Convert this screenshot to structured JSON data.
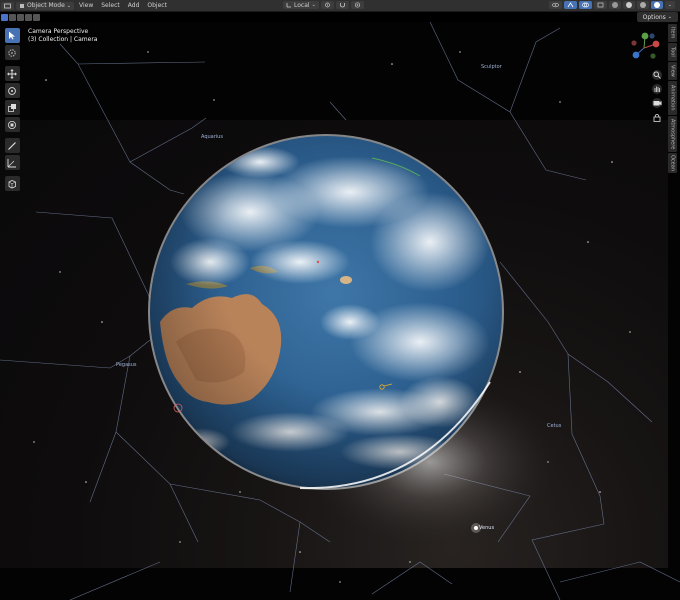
{
  "header": {
    "mode": "Object Mode",
    "menus": [
      "View",
      "Select",
      "Add",
      "Object"
    ],
    "transform_orientation": "Local",
    "options_label": "Options"
  },
  "overlay": {
    "line1": "Camera Perspective",
    "line2": "(3) Collection | Camera"
  },
  "constellations": [
    "Sculptor",
    "Aquarius",
    "Pegasus",
    "Cetus",
    "Venus"
  ],
  "side_tabs": [
    "Item",
    "Tool",
    "View",
    "Animation",
    "Atmosphere",
    "Ocean"
  ],
  "colors": {
    "header_bg": "#303030",
    "accent": "#4772b3",
    "ocean": "#2c5f8f",
    "land": "#b9835a",
    "constellation_line": "#7f8fb0"
  },
  "icons": [
    "cursor-icon",
    "crosshair-icon",
    "move-icon",
    "rotate-icon",
    "scale-icon",
    "transform-icon",
    "annotate-icon",
    "measure-icon",
    "add-cube-icon",
    "zoom-icon",
    "hand-icon",
    "camera-icon",
    "lock-icon"
  ]
}
